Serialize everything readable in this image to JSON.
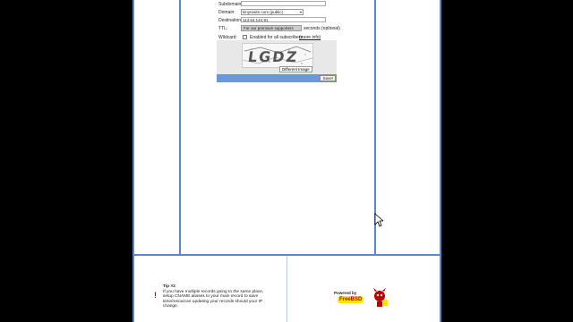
{
  "form": {
    "subdomain_label": "Subdomain:",
    "subdomain_value": "",
    "domain_label": "Domain:",
    "domain_selected": "kinyrealm.com (public)",
    "destination_label": "Destination:",
    "destination_value": "113.54.144.91",
    "ttl_label": "TTL:",
    "ttl_box_text": "For our premium supporters",
    "ttl_suffix": "seconds (optional)",
    "wildcard_label": "Wildcard:",
    "wildcard_text": "Enabled for all subscribers",
    "wildcard_more": "(more info)",
    "captcha_text": "LGDZ",
    "different_image_label": "Different Image",
    "save_label": "Save!"
  },
  "tip": {
    "title": "Tip #2",
    "body": "If you have multiple records going to the same place, setup CNAME aliases to your main record to save time/resources updating your records should your IP change."
  },
  "badge": {
    "powered_by": "Powered by",
    "brand": "FreeBSD"
  },
  "colors": {
    "border_blue": "#5b86cc",
    "save_bar": "#6b98dc",
    "background": "#000000"
  }
}
